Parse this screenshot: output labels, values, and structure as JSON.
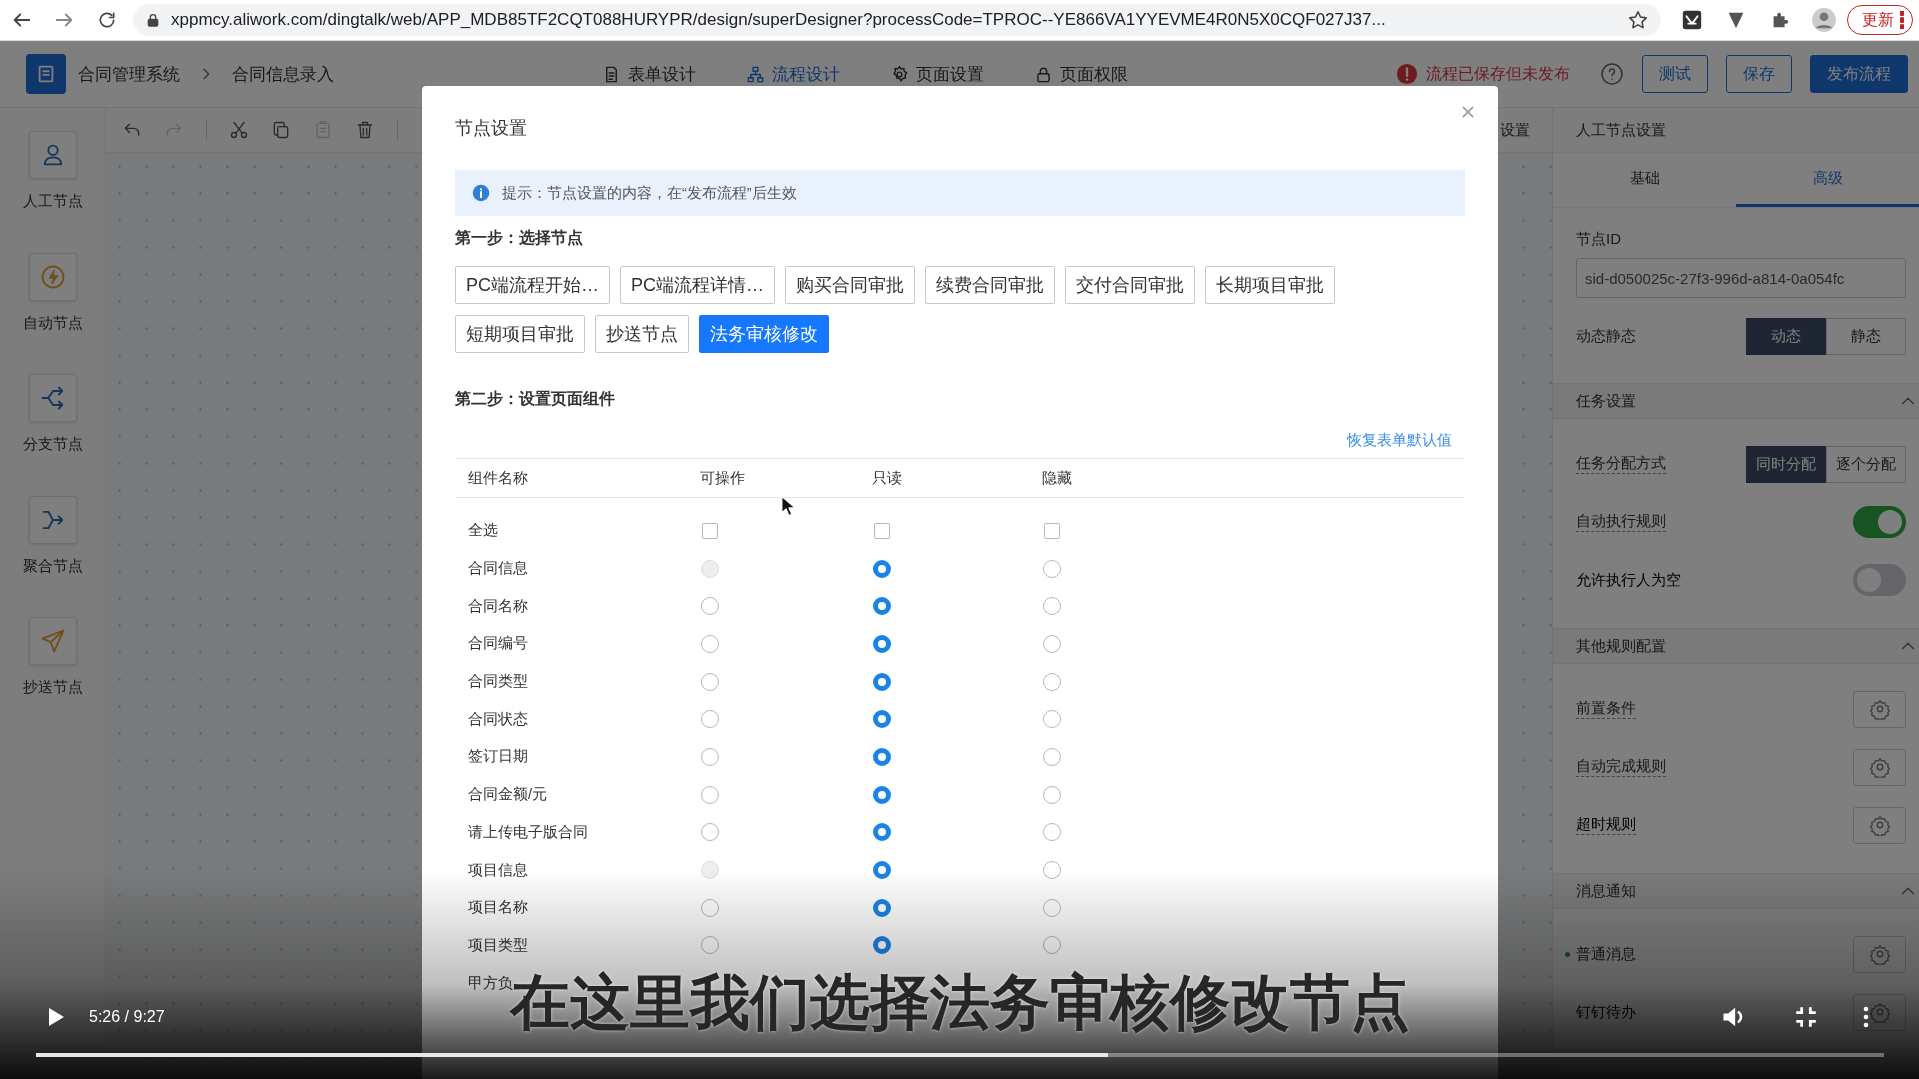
{
  "browser": {
    "url": "xppmcy.aliwork.com/dingtalk/web/APP_MDB85TF2CQT088HURYPR/design/superDesigner?processCode=TPROC--YE866VA1YYEVME4R0N5X0CQF027J37...",
    "update_label": "更新"
  },
  "app_header": {
    "app_name": "合同管理系统",
    "page_name": "合同信息录入",
    "tabs": [
      {
        "label": "表单设计",
        "selected": false
      },
      {
        "label": "流程设计",
        "selected": true
      },
      {
        "label": "页面设置",
        "selected": false
      },
      {
        "label": "页面权限",
        "selected": false
      }
    ],
    "status": "流程已保存但未发布",
    "buttons": [
      {
        "label": "测试",
        "kind": "outline"
      },
      {
        "label": "保存",
        "kind": "outline"
      },
      {
        "label": "发布流程",
        "kind": "primary"
      }
    ]
  },
  "node_palette": [
    {
      "label": "人工节点"
    },
    {
      "label": "自动节点"
    },
    {
      "label": "分支节点"
    },
    {
      "label": "聚合节点"
    },
    {
      "label": "抄送节点"
    }
  ],
  "toolbar": [
    {
      "disabled": false
    },
    {
      "disabled": true
    },
    {
      "disabled": false
    },
    {
      "disabled": false
    },
    {
      "disabled": true
    },
    {
      "disabled": false
    }
  ],
  "canvas": {
    "header_fragment": "设置"
  },
  "modal": {
    "title": "节点设置",
    "notice": "提示：节点设置的内容，在“发布流程”后生效",
    "step1": "第一步：选择节点",
    "nodes": [
      {
        "label": "PC端流程开始…",
        "selected": false
      },
      {
        "label": "PC端流程详情…",
        "selected": false
      },
      {
        "label": "购买合同审批",
        "selected": false
      },
      {
        "label": "续费合同审批",
        "selected": false
      },
      {
        "label": "交付合同审批",
        "selected": false
      },
      {
        "label": "长期项目审批",
        "selected": false
      },
      {
        "label": "短期项目审批",
        "selected": false
      },
      {
        "label": "抄送节点",
        "selected": false
      },
      {
        "label": "法务审核修改",
        "selected": true
      }
    ],
    "step2": "第二步：设置页面组件",
    "reset_link": "恢复表单默认值",
    "columns": [
      "组件名称",
      "可操作",
      "只读",
      "隐藏"
    ],
    "rows": [
      {
        "name": "全选",
        "kind": "checkbox",
        "cells": [
          {
            "checked": false
          },
          {
            "checked": false
          },
          {
            "checked": false
          }
        ]
      },
      {
        "name": "合同信息",
        "kind": "radio",
        "cells": [
          {
            "selected": false,
            "disabled": true
          },
          {
            "selected": true,
            "disabled": false
          },
          {
            "selected": false,
            "disabled": false
          }
        ]
      },
      {
        "name": "合同名称",
        "kind": "radio",
        "cells": [
          {
            "selected": false,
            "disabled": false
          },
          {
            "selected": true,
            "disabled": false
          },
          {
            "selected": false,
            "disabled": false
          }
        ]
      },
      {
        "name": "合同编号",
        "kind": "radio",
        "cells": [
          {
            "selected": false,
            "disabled": false
          },
          {
            "selected": true,
            "disabled": false
          },
          {
            "selected": false,
            "disabled": false
          }
        ]
      },
      {
        "name": "合同类型",
        "kind": "radio",
        "cells": [
          {
            "selected": false,
            "disabled": false
          },
          {
            "selected": true,
            "disabled": false
          },
          {
            "selected": false,
            "disabled": false
          }
        ]
      },
      {
        "name": "合同状态",
        "kind": "radio",
        "cells": [
          {
            "selected": false,
            "disabled": false
          },
          {
            "selected": true,
            "disabled": false
          },
          {
            "selected": false,
            "disabled": false
          }
        ]
      },
      {
        "name": "签订日期",
        "kind": "radio",
        "cells": [
          {
            "selected": false,
            "disabled": false
          },
          {
            "selected": true,
            "disabled": false
          },
          {
            "selected": false,
            "disabled": false
          }
        ]
      },
      {
        "name": "合同金额/元",
        "kind": "radio",
        "cells": [
          {
            "selected": false,
            "disabled": false
          },
          {
            "selected": true,
            "disabled": false
          },
          {
            "selected": false,
            "disabled": false
          }
        ]
      },
      {
        "name": "请上传电子版合同",
        "kind": "radio",
        "cells": [
          {
            "selected": false,
            "disabled": false
          },
          {
            "selected": true,
            "disabled": false
          },
          {
            "selected": false,
            "disabled": false
          }
        ]
      },
      {
        "name": "项目信息",
        "kind": "radio",
        "cells": [
          {
            "selected": false,
            "disabled": true
          },
          {
            "selected": true,
            "disabled": false
          },
          {
            "selected": false,
            "disabled": false
          }
        ]
      },
      {
        "name": "项目名称",
        "kind": "radio",
        "cells": [
          {
            "selected": false,
            "disabled": false
          },
          {
            "selected": true,
            "disabled": false
          },
          {
            "selected": false,
            "disabled": false
          }
        ]
      },
      {
        "name": "项目类型",
        "kind": "radio",
        "cells": [
          {
            "selected": false,
            "disabled": false
          },
          {
            "selected": true,
            "disabled": false
          },
          {
            "selected": false,
            "disabled": false
          }
        ]
      },
      {
        "name": "甲方负",
        "kind": "label"
      }
    ]
  },
  "right_panel": {
    "title": "人工节点设置",
    "tabs": [
      {
        "label": "基础",
        "selected": false
      },
      {
        "label": "高级",
        "selected": true
      }
    ],
    "node_id": {
      "label": "节点ID",
      "value": "sid-d050025c-27f3-996d-a814-0a054fc"
    },
    "mode": {
      "label": "动态静态",
      "options": [
        {
          "label": "动态",
          "selected": true
        },
        {
          "label": "静态",
          "selected": false
        }
      ]
    },
    "sections": [
      {
        "title": "任务设置",
        "expanded": true,
        "rows": [
          {
            "kind": "segmented",
            "label": "任务分配方式",
            "tooltip": true,
            "options": [
              {
                "label": "同时分配",
                "selected": true
              },
              {
                "label": "逐个分配",
                "selected": false
              }
            ]
          },
          {
            "kind": "switch",
            "label": "自动执行规则",
            "tooltip": true,
            "on": true
          },
          {
            "kind": "switch",
            "label": "允许执行人为空",
            "tooltip": false,
            "on": false
          }
        ]
      },
      {
        "title": "其他规则配置",
        "expanded": true,
        "rows": [
          {
            "kind": "settings",
            "label": "前置条件",
            "tooltip": true
          },
          {
            "kind": "settings",
            "label": "自动完成规则",
            "tooltip": true
          },
          {
            "kind": "settings",
            "label": "超时规则",
            "tooltip": true
          }
        ]
      },
      {
        "title": "消息通知",
        "expanded": true,
        "rows": [
          {
            "kind": "settings",
            "label": "普通消息",
            "tooltip": false,
            "active": true
          },
          {
            "kind": "settings",
            "label": "钉钉待办",
            "tooltip": false,
            "active": false
          }
        ]
      }
    ]
  },
  "video": {
    "playing": false,
    "time": "5:26 / 9:27",
    "subtitle": "在这里我们选择法务审核修改节点",
    "level": 0.58
  }
}
